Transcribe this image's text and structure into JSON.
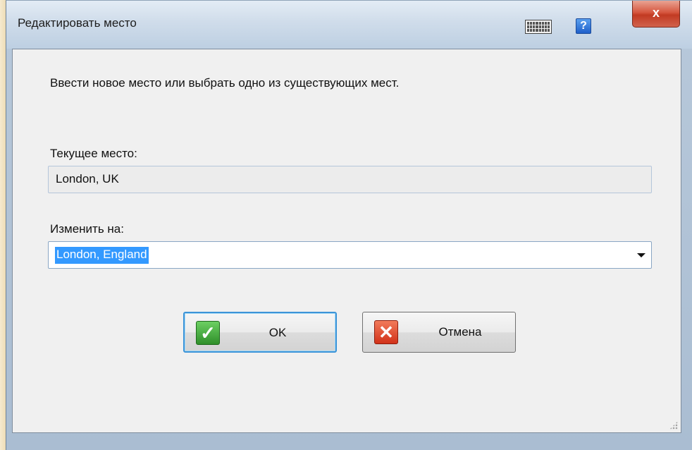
{
  "window": {
    "title": "Редактировать место",
    "close_label": "x",
    "help_label": "?"
  },
  "dialog": {
    "prompt": "Ввести новое место или выбрать одно из существующих мест.",
    "current_label": "Текущее место:",
    "current_value": "London, UK",
    "change_label": "Изменить на:",
    "change_value": "London, England"
  },
  "buttons": {
    "ok_label": "OK",
    "cancel_label": "Отмена"
  },
  "icons": {
    "keyboard": "keyboard-icon",
    "help": "help-icon",
    "close": "close-icon",
    "ok": "checkmark-icon",
    "cancel": "cross-icon",
    "dropdown": "chevron-down-icon"
  },
  "colors": {
    "selection": "#3399ff",
    "ok_icon": "#2f8f2a",
    "cancel_icon": "#d2321a",
    "close_button": "#c23a22"
  }
}
